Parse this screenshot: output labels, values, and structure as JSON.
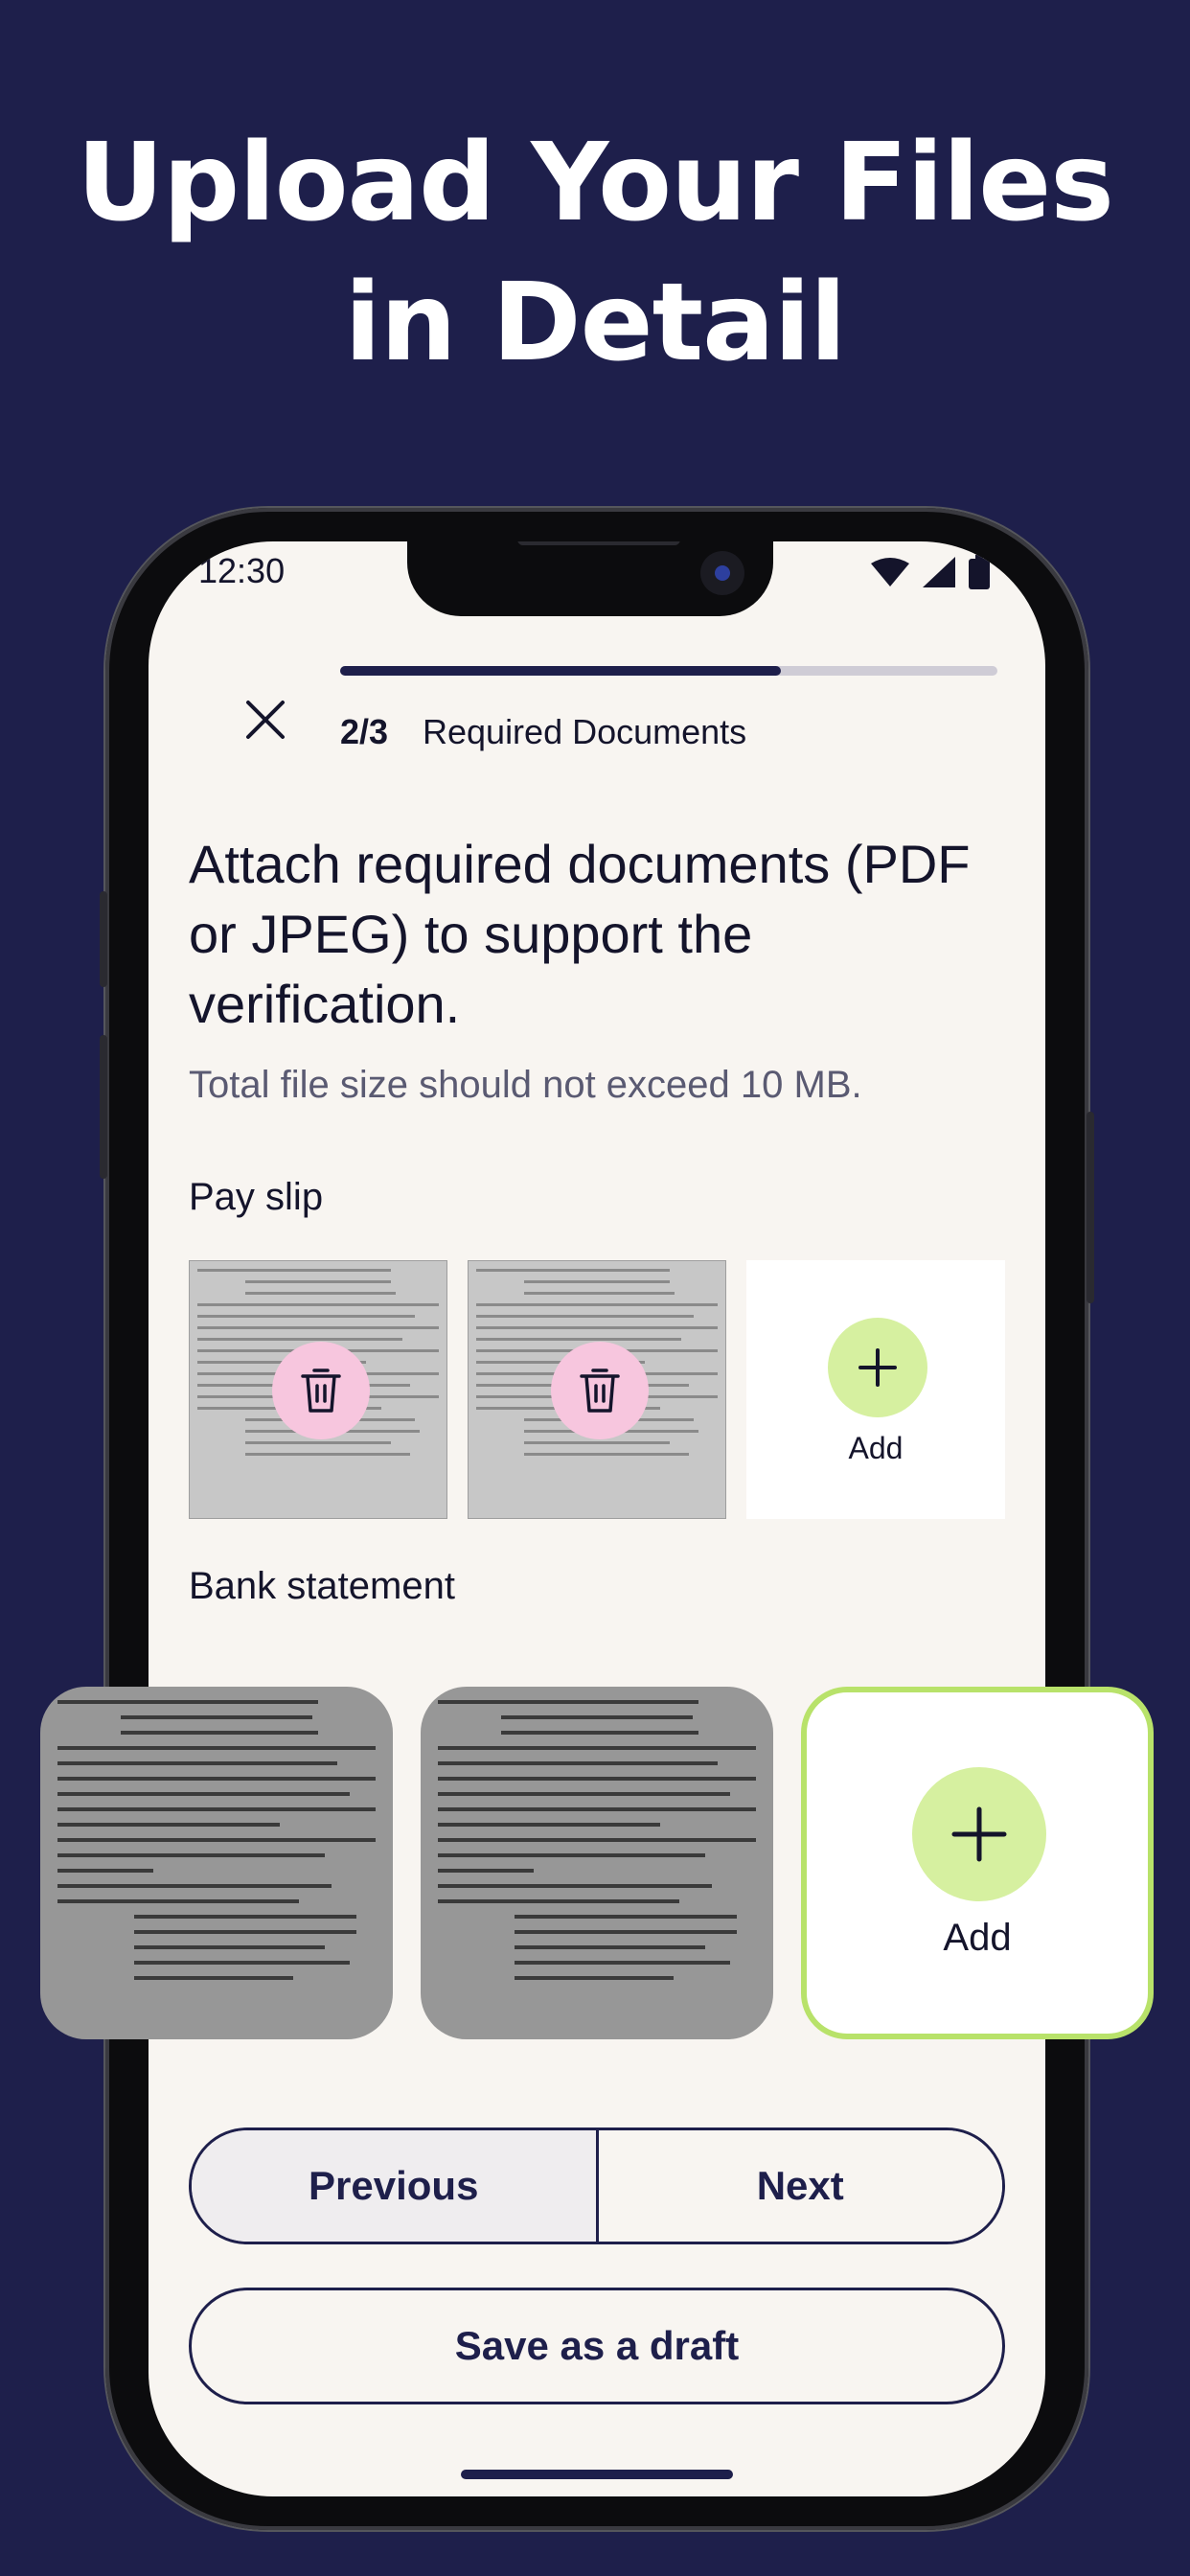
{
  "headline": {
    "line1": "Upload Your Files",
    "line2": "in Detail"
  },
  "status_bar": {
    "time": "12:30"
  },
  "header": {
    "progress": 0.67,
    "step": "2/3",
    "title": "Required Documents"
  },
  "main": {
    "title": "Attach required documents (PDF or JPEG) to support the verification.",
    "subtitle": "Total file size should not exceed 10 MB."
  },
  "sections": {
    "pay_slip": {
      "label": "Pay slip",
      "add_label": "Add"
    },
    "bank_statement": {
      "label": "Bank statement",
      "add_label": "Add"
    }
  },
  "buttons": {
    "previous": "Previous",
    "next": "Next",
    "save_draft": "Save as a draft"
  },
  "colors": {
    "background": "#1e1f4b",
    "accent_green": "#d6f0a0",
    "delete_pink": "#f7c6de",
    "screen": "#f8f5f1"
  },
  "icons": [
    "close-icon",
    "trash-icon",
    "plus-icon",
    "wifi-icon",
    "signal-icon",
    "battery-icon"
  ]
}
